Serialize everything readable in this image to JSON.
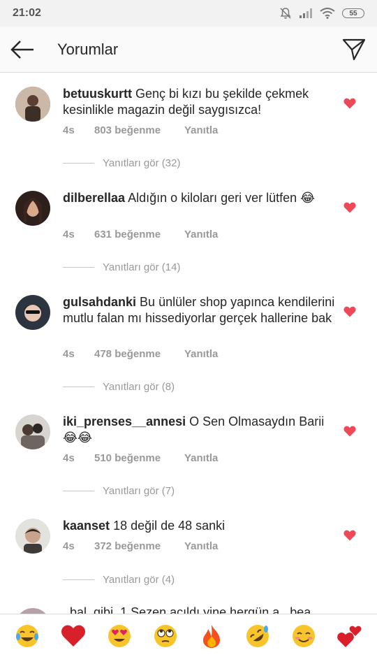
{
  "status_bar": {
    "time": "21:02",
    "battery": "55"
  },
  "header": {
    "title": "Yorumlar"
  },
  "comments": [
    {
      "username": "betuuskurtt",
      "text": "Genç bi kızı bu şekilde çekmek kesinlikle magazin değil saygısızca!",
      "age": "4s",
      "likes": "803 beğenme",
      "reply": "Yanıtla",
      "view_replies": "Yanıtları gör (32)",
      "avatar_color": "#8a6a5a"
    },
    {
      "username": "dilberellaa",
      "text": "Aldığın o kiloları geri ver lütfen 😂",
      "age": "4s",
      "likes": "631 beğenme",
      "reply": "Yanıtla",
      "view_replies": "Yanıtları gör (14)",
      "avatar_color": "#3a2a28"
    },
    {
      "username": "gulsahdanki",
      "text": "Bu ünlüler shop yapınca kendilerini mutlu falan mı hissediyorlar gerçek hallerine bak",
      "age": "4s",
      "likes": "478 beğenme",
      "reply": "Yanıtla",
      "view_replies": "Yanıtları gör (8)",
      "avatar_color": "#2c3440"
    },
    {
      "username": "iki_prenses__annesi",
      "text": "O Sen Olmasaydın Barii 😂😂",
      "age": "4s",
      "likes": "510 beğenme",
      "reply": "Yanıtla",
      "view_replies": "Yanıtları gör (7)",
      "avatar_color": "#7a6f6a"
    },
    {
      "username": "kaanset",
      "text": "18 değil de 48 sanki",
      "age": "4s",
      "likes": "372 beğenme",
      "reply": "Yanıtla",
      "view_replies": "Yanıtları gör (4)",
      "avatar_color": "#5c5650"
    }
  ],
  "partial_comment": {
    "text": "_bal_gibi_1 Sezen açıldı yine hergün a...bea"
  },
  "emoji_bar": [
    "laughing-tears-emoji",
    "red-heart-emoji",
    "heart-eyes-emoji",
    "eye-roll-emoji",
    "fire-emoji",
    "rofl-emoji",
    "smiling-blush-emoji",
    "two-hearts-emoji"
  ],
  "colors": {
    "heart": "#ed4956",
    "meta": "#999999",
    "text": "#262626"
  }
}
